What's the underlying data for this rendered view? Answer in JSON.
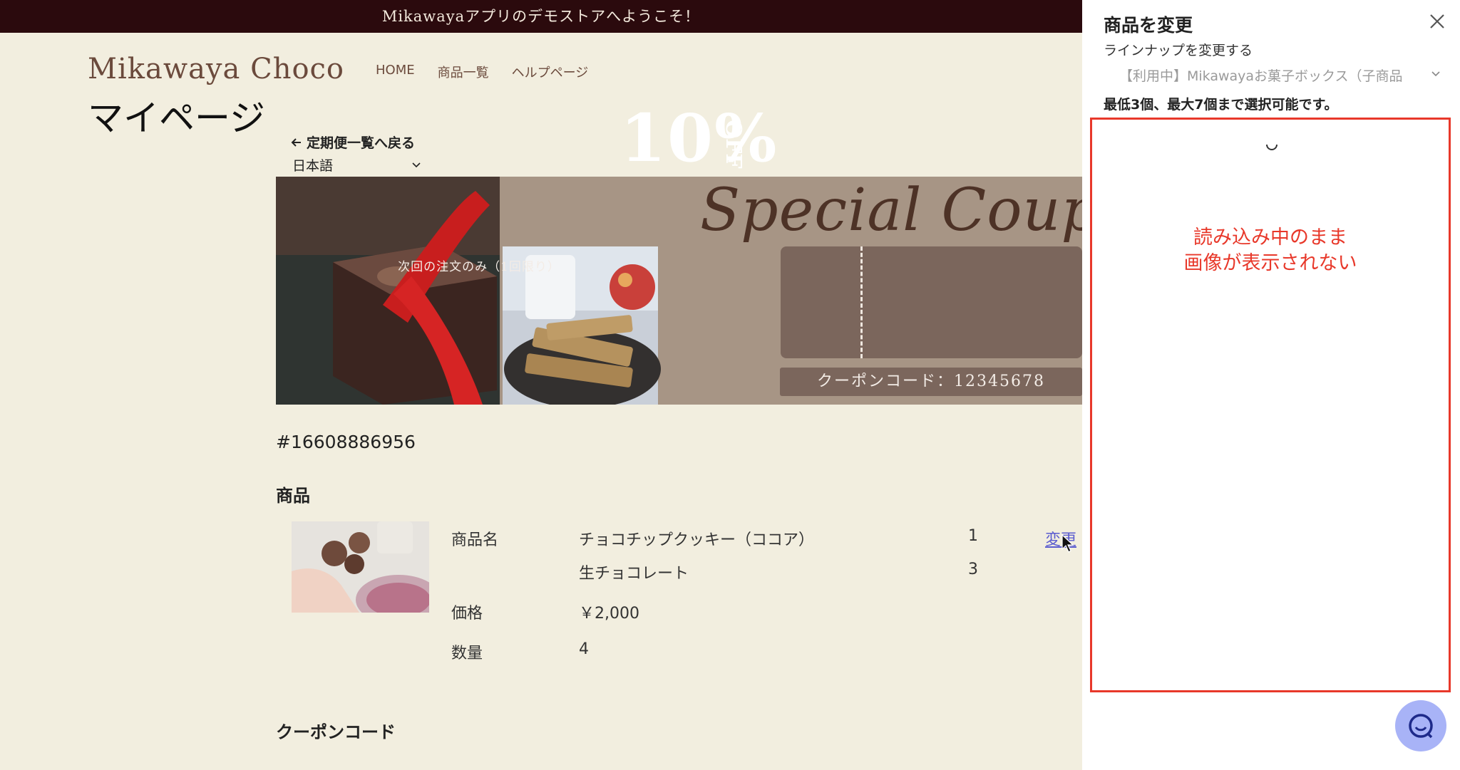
{
  "announcement": "Mikawayaアプリのデモストアへようこそ！",
  "header": {
    "brand": "Mikawaya Choco",
    "nav": [
      "HOME",
      "商品一覧",
      "ヘルプページ"
    ]
  },
  "page": {
    "title": "マイページ",
    "back_link": "定期便一覧へ戻る",
    "language": "日本語"
  },
  "banner": {
    "script_text": "Special Coupon",
    "caption": "次回の注文のみ（1回限り）",
    "discount": "10%",
    "off_label": "OFF",
    "coupon_code": "クーポンコード：12345678"
  },
  "order": {
    "id": "#16608886956",
    "products_heading": "商品",
    "labels": {
      "name": "商品名",
      "price": "価格",
      "quantity": "数量"
    },
    "items": [
      {
        "name": "チョコチップクッキー（ココア）",
        "qty": "1"
      },
      {
        "name": "生チョコレート",
        "qty": "3"
      }
    ],
    "price": "￥2,000",
    "quantity": "4",
    "change_link": "変更",
    "coupon_heading": "クーポンコード"
  },
  "drawer": {
    "title": "商品を変更",
    "subtitle": "ラインナップを変更する",
    "select_value": "【利用中】Mikawayaお菓子ボックス（子商品",
    "note": "最低3個、最大7個まで選択可能です。",
    "annotation_line1": "読み込み中のまま",
    "annotation_line2": "画像が表示されない"
  },
  "colors": {
    "announce_bg": "#2b0a0d",
    "page_bg": "#f2eedf",
    "brand": "#6b4a3c",
    "link": "#5b5ccf",
    "annotation": "#e8382a",
    "chat_button": "#a8b3f7"
  },
  "icons": [
    "arrow-left-icon",
    "chevron-down-icon",
    "close-icon",
    "spinner-icon",
    "chat-icon",
    "cursor-icon"
  ]
}
